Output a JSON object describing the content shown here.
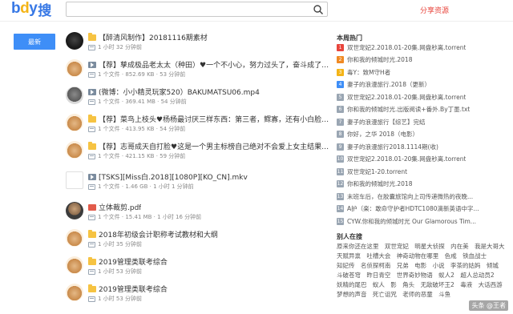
{
  "header": {
    "logo_text_1": "b",
    "logo_text_2": "d",
    "logo_text_3": "y",
    "logo_text_4": "搜",
    "search_value": "",
    "share_label": "分享资源"
  },
  "latest_button": "最新",
  "results": [
    {
      "icon": "folder-icon",
      "thumb": "dark",
      "title": "【醉清风制作】20181116期素材",
      "meta": "1 小时 32 分钟前"
    },
    {
      "icon": "video-icon",
      "thumb": "bear",
      "title": "【荐】孳成极品老太太（种田）♥一个不小心，努力过头了，奋斗成了侯夫人。",
      "meta": "1 个文件 · 852.69 KB · 53 分钟前"
    },
    {
      "icon": "video-icon",
      "thumb": "face",
      "title": "(微博：小小精灵玩家520）BAKUMATSU06.mp4",
      "meta": "1 个文件 · 369.41 MB · 54 分钟前"
    },
    {
      "icon": "folder-icon",
      "thumb": "bear",
      "title": "【荐】菜鸟上枝头♥杨杨最讨厌三样东西：第三者，鳏寡，还有小白脸。可若...",
      "meta": "1 个文件 · 413.95 KB · 54 分钟前"
    },
    {
      "icon": "folder-icon",
      "thumb": "bear",
      "title": "【荐】志哥成天自打脸♥这是一个男主标榜自己绝对不会爱上女主结果打脸到...",
      "meta": "1 个文件 · 421.15 KB · 59 分钟前"
    },
    {
      "icon": "video-icon",
      "thumb": "blank",
      "title": "[TSKS][Miss白.2018][1080P][KO_CN].mkv",
      "meta": "1 个文件 · 1.46 GB · 1 小时 1 分钟前"
    },
    {
      "icon": "pdf-icon",
      "thumb": "person",
      "title": "立体裁剪.pdf",
      "meta": "1 个文件 · 15.41 MB · 1 小时 16 分钟前"
    },
    {
      "icon": "folder-icon",
      "thumb": "bear",
      "title": "2018年初级会计职称考试教材和大纲",
      "meta": "1 小时 35 分钟前"
    },
    {
      "icon": "folder-icon",
      "thumb": "bear",
      "title": "2019管理类联考综合",
      "meta": "1 小时 53 分钟前"
    },
    {
      "icon": "folder-icon",
      "thumb": "bear",
      "title": "2019管理类联考综合",
      "meta": "1 小时 53 分钟前"
    }
  ],
  "sidebar": {
    "hot_title": "本周热门",
    "hot_items": [
      {
        "num": "1",
        "color": "#e8453c",
        "text": "双世宠妃2.2018.01-20集.网盘秒离.torrent"
      },
      {
        "num": "2",
        "color": "#f08a24",
        "text": "你和我的倾城时光.2018"
      },
      {
        "num": "3",
        "color": "#f4b417",
        "text": "毒Y：致M守H者"
      },
      {
        "num": "4",
        "color": "#3e8ef7",
        "text": "妻子的浪漫旅行.2018（更新）"
      },
      {
        "num": "5",
        "color": "#9aa6b3",
        "text": "双世宠妃2.2018.01-20集.网盘秒离.torrent"
      },
      {
        "num": "6",
        "color": "#9aa6b3",
        "text": "你和我的倾城时光.出版阅读+番外.By丁墨.txt"
      },
      {
        "num": "7",
        "color": "#9aa6b3",
        "text": "妻子的浪漫旅行【综艺】完结"
      },
      {
        "num": "8",
        "color": "#9aa6b3",
        "text": "你好，之华 2018（电影）"
      },
      {
        "num": "9",
        "color": "#9aa6b3",
        "text": "妻子的浪漫旅行2018.1114期(收)"
      },
      {
        "num": "10",
        "color": "#9aa6b3",
        "text": "双世宠妃2.2018.01-20集.网盘秒离.torrent"
      },
      {
        "num": "11",
        "color": "#9aa6b3",
        "text": "双世宠妃1-20.torrent"
      },
      {
        "num": "12",
        "color": "#9aa6b3",
        "text": "你和我的倾城时光.2018"
      },
      {
        "num": "13",
        "color": "#9aa6b3",
        "text": "末班车后，在胶囊旅馆向上司传递微热的夜晚..."
      },
      {
        "num": "14",
        "color": "#9aa6b3",
        "text": "A护（楽：敢命守护者HDTC1080滴新英语中字..."
      },
      {
        "num": "15",
        "color": "#9aa6b3",
        "text": "CYW.你和我的倾城时光 Our Glamorous Tim..."
      }
    ],
    "tags_title": "别人在搜",
    "tags": [
      "原来你还在这里",
      "双世宠妃",
      "明星大侦探",
      "内在美",
      "我是大哥大",
      "天赋异禀",
      "吐槽大会",
      "神奇动物在哪里",
      "色戒",
      "铁血战士",
      "知妃传",
      "名侦探柯南",
      "兄弟",
      "电影",
      "小说",
      "李茶的姑妈",
      "倾城",
      "斗破苍穹",
      "昨日青空",
      "世界奇妙物语",
      "蚁人2",
      "超人总动员2",
      "妖精的尾巴",
      "蚁人",
      "影",
      "角头",
      "无敌破坏王2",
      "毒液",
      "大话西游",
      "梦想的声音",
      "死亡诅咒",
      "老师的恶童",
      "斗鱼"
    ]
  },
  "watermark": "头条 @王者"
}
